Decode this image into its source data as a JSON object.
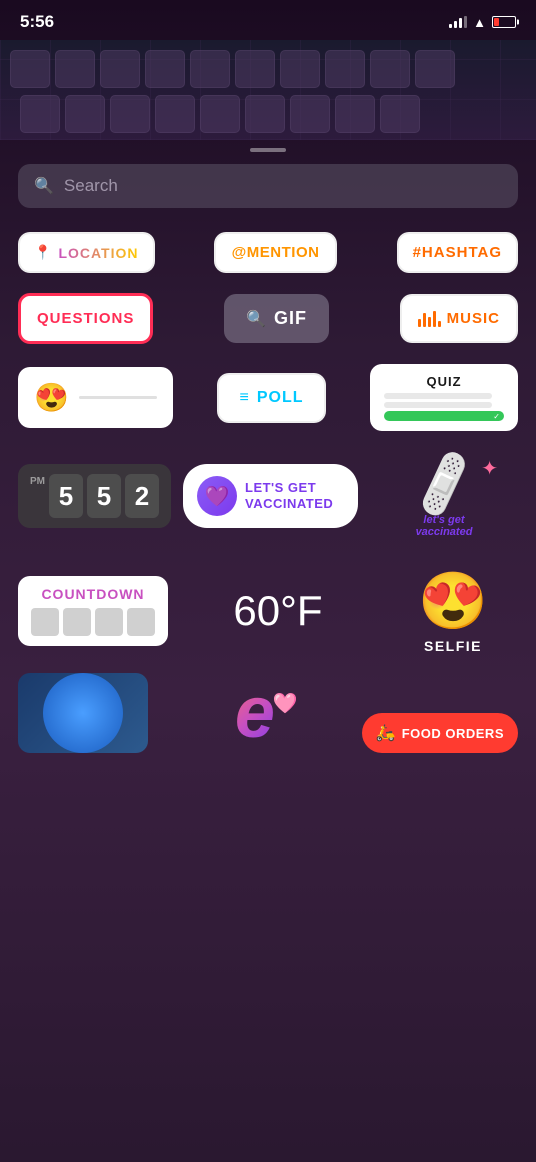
{
  "statusBar": {
    "time": "5:56"
  },
  "search": {
    "placeholder": "Search"
  },
  "stickers": {
    "row1": [
      {
        "id": "location",
        "label": "LOCATION",
        "icon": "📍"
      },
      {
        "id": "mention",
        "label": "@MENTION"
      },
      {
        "id": "hashtag",
        "label": "#HASHTAG"
      }
    ],
    "row2": [
      {
        "id": "questions",
        "label": "QUESTIONS"
      },
      {
        "id": "gif",
        "label": "GIF"
      },
      {
        "id": "music",
        "label": "MUSIC"
      }
    ],
    "row3": [
      {
        "id": "emoji-slider",
        "emoji": "😍"
      },
      {
        "id": "poll",
        "label": "POLL",
        "icon": "≡"
      },
      {
        "id": "quiz",
        "label": "QUIZ"
      }
    ],
    "row4": [
      {
        "id": "clock",
        "digits": [
          "5",
          "5",
          "2"
        ],
        "period": "PM"
      },
      {
        "id": "vaccinated",
        "label": "LET'S GET\nVACCINATED"
      },
      {
        "id": "bandage",
        "caption": "let's get\nvaccinated"
      }
    ],
    "row5": [
      {
        "id": "countdown",
        "label": "COUNTDOWN"
      },
      {
        "id": "temperature",
        "label": "60°F"
      },
      {
        "id": "selfie",
        "label": "SELFIE"
      }
    ],
    "bottom": [
      {
        "id": "globe"
      },
      {
        "id": "letter-e"
      },
      {
        "id": "food-orders",
        "label": "FOOD ORDERS"
      }
    ]
  }
}
